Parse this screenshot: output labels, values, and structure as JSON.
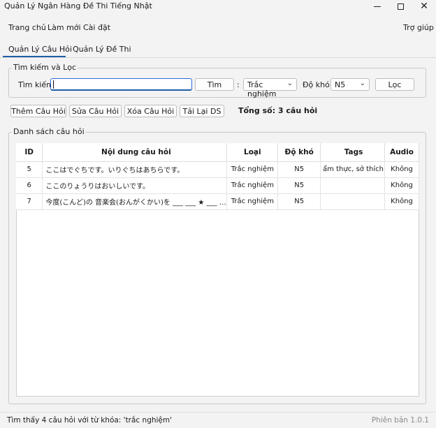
{
  "window": {
    "title": "Quản Lý Ngân Hàng Đề Thi Tiếng Nhật",
    "close_glyph": "✕"
  },
  "menu": {
    "home": "Trang chủ",
    "new": "Làm mới",
    "settings": "Cài đặt",
    "help": "Trợ giúp"
  },
  "tabs": {
    "questions": "Quản Lý Câu Hỏi",
    "exams": "Quản Lý Đề Thi",
    "active": "questions"
  },
  "search": {
    "group_title": "Tìm kiếm và Lọc",
    "keyword_label": "Tìm kiếm:",
    "keyword_value": "",
    "search_button": "Tìm",
    "separator": ":",
    "type_selected": "Trắc nghiệm",
    "level_label": "Độ khó:",
    "level_selected": "N5",
    "filter_button": "Lọc"
  },
  "actions": {
    "add": "Thêm Câu Hỏi",
    "edit": "Sửa Câu Hỏi",
    "delete": "Xóa Câu Hỏi",
    "reload": "Tải Lại DS",
    "total": "Tổng số: 3 câu hỏi"
  },
  "list": {
    "group_title": "Danh sách câu hỏi",
    "columns": {
      "id": "ID",
      "content": "Nội dung câu hỏi",
      "type": "Loại",
      "level": "Độ khó",
      "tags": "Tags",
      "audio": "Audio"
    },
    "rows": [
      {
        "id": "5",
        "content": "ここはでぐちです。いりぐちはあちらです。",
        "type": "Trắc nghiệm",
        "level": "N5",
        "tags": "ẩm thực, sở thích",
        "audio": "Không"
      },
      {
        "id": "6",
        "content": "ここのりょうりはおいしいです。",
        "type": "Trắc nghiệm",
        "level": "N5",
        "tags": "",
        "audio": "Không"
      },
      {
        "id": "7",
        "content": "今度(こんど)の 音楽会(おんがくかい)を ___ ___ ★ ___ です。",
        "type": "Trắc nghiệm",
        "level": "N5",
        "tags": "",
        "audio": "Không"
      }
    ]
  },
  "status": {
    "message": "Tìm thấy 4 câu hỏi với từ khóa: 'trắc nghiệm'",
    "version": "Phiên bản 1.0.1"
  },
  "colors": {
    "accent": "#1f5fa8",
    "focus": "#2e6fd9",
    "background": "#f3f3f3"
  }
}
